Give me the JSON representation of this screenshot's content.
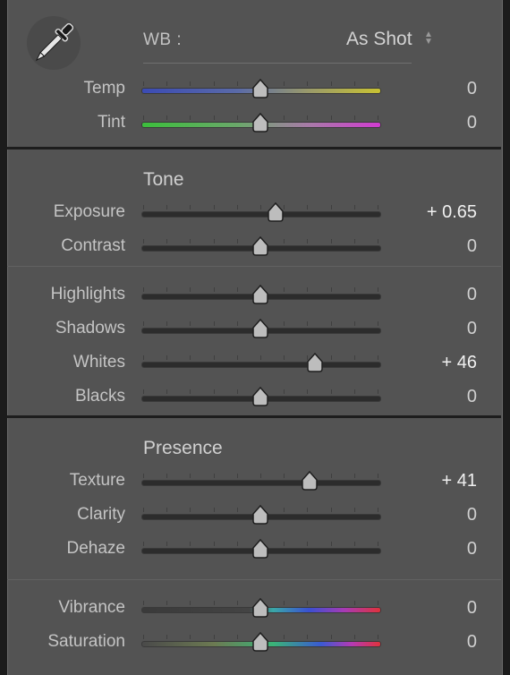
{
  "white_balance": {
    "label": "WB :",
    "value": "As Shot",
    "eyedropper_icon": "eyedropper-icon",
    "stepper_icon": "up-down-arrows-icon",
    "rows": [
      {
        "label": "Temp",
        "value": "0",
        "position": 0.5,
        "track": "temp"
      },
      {
        "label": "Tint",
        "value": "0",
        "position": 0.5,
        "track": "tint"
      }
    ]
  },
  "tone": {
    "title": "Tone",
    "rows": [
      {
        "label": "Exposure",
        "value": "+ 0.65",
        "position": 0.565
      },
      {
        "label": "Contrast",
        "value": "0",
        "position": 0.5
      },
      {
        "label": "Highlights",
        "value": "0",
        "position": 0.5
      },
      {
        "label": "Shadows",
        "value": "0",
        "position": 0.5
      },
      {
        "label": "Whites",
        "value": "+ 46",
        "position": 0.73
      },
      {
        "label": "Blacks",
        "value": "0",
        "position": 0.5
      }
    ]
  },
  "presence": {
    "title": "Presence",
    "rows": [
      {
        "label": "Texture",
        "value": "+ 41",
        "position": 0.705
      },
      {
        "label": "Clarity",
        "value": "0",
        "position": 0.5
      },
      {
        "label": "Dehaze",
        "value": "0",
        "position": 0.5
      },
      {
        "label": "Vibrance",
        "value": "0",
        "position": 0.5,
        "track": "vibrance"
      },
      {
        "label": "Saturation",
        "value": "0",
        "position": 0.5,
        "track": "saturation"
      }
    ]
  },
  "colors": {
    "panel_bg": "#535353",
    "divider": "#1d1d1d",
    "thumb": "#bdbdbd"
  }
}
